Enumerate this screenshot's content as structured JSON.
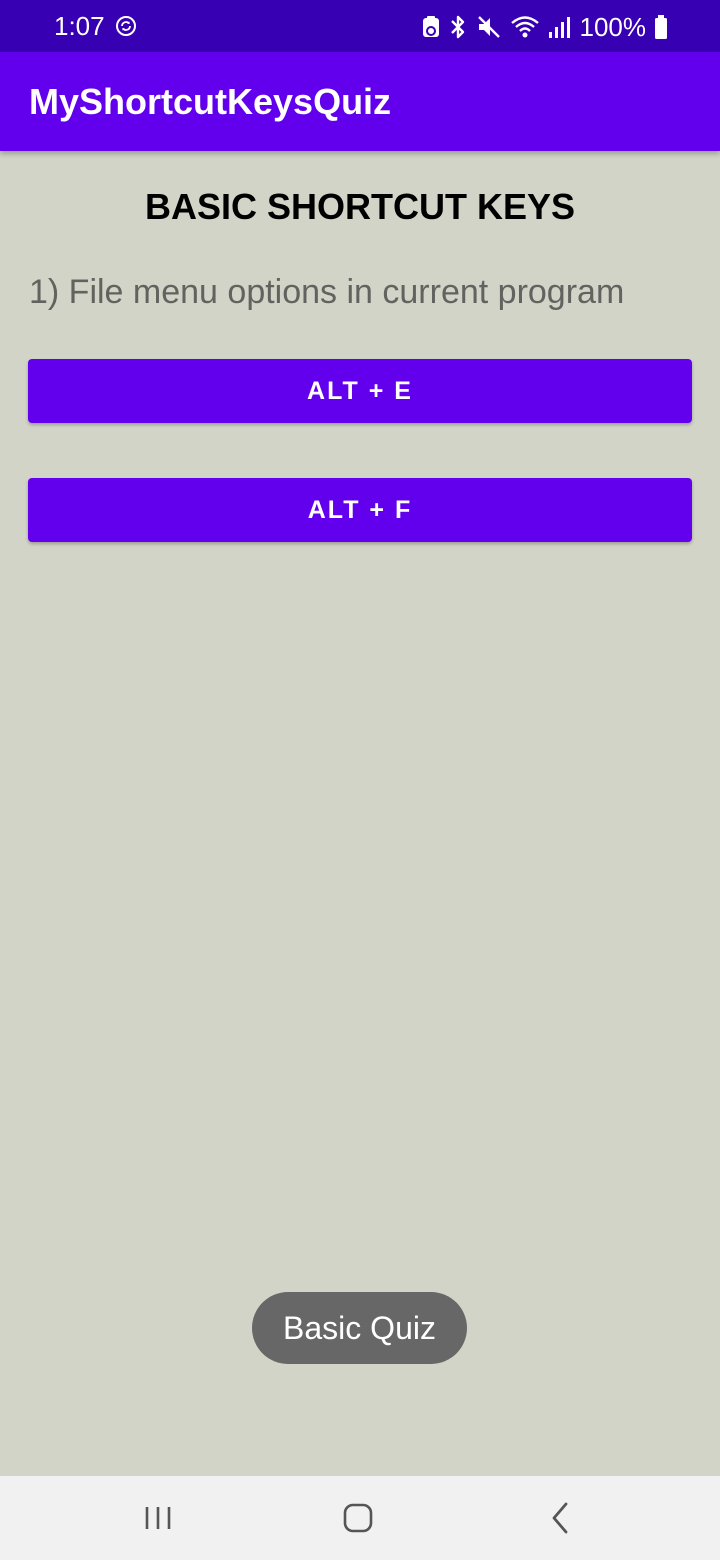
{
  "status_bar": {
    "time": "1:07",
    "battery_text": "100%",
    "icons": [
      "sync-icon",
      "nfc-icon",
      "bluetooth-icon",
      "mute-icon",
      "wifi-icon",
      "signal-icon",
      "battery-icon"
    ]
  },
  "app_bar": {
    "title": "MyShortcutKeysQuiz"
  },
  "content": {
    "heading": "BASIC SHORTCUT KEYS",
    "question": "1) File menu options in current program",
    "options": [
      "ALT + E",
      "ALT + F"
    ]
  },
  "toast": {
    "text": "Basic Quiz"
  },
  "nav_bar": {
    "icons": [
      "recents-icon",
      "home-icon",
      "back-icon"
    ]
  },
  "colors": {
    "status_bar": "#3700b3",
    "primary": "#6200ee",
    "background": "#d3d4c8",
    "toast": "#676767",
    "nav_bar": "#f1f1f1"
  }
}
